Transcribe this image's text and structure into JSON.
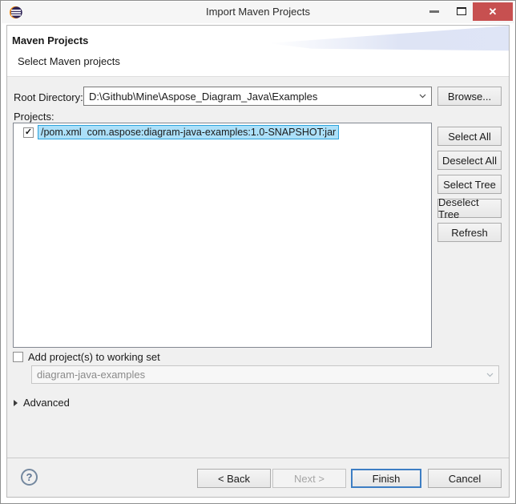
{
  "window": {
    "title": "Import Maven Projects",
    "close_glyph": "✕"
  },
  "header": {
    "title": "Maven Projects",
    "subtitle": "Select Maven projects"
  },
  "form": {
    "root_directory": {
      "label": "Root Directory:",
      "value": "D:\\Github\\Mine\\Aspose_Diagram_Java\\Examples",
      "browse_label": "Browse..."
    },
    "projects_label": "Projects:",
    "project_items": [
      {
        "checked": true,
        "selected": true,
        "label": "/pom.xml  com.aspose:diagram-java-examples:1.0-SNAPSHOT:jar"
      }
    ],
    "side_buttons": [
      "Select All",
      "Deselect All",
      "Select Tree",
      "Deselect Tree",
      "Refresh"
    ],
    "working_set": {
      "label": "Add project(s) to working set",
      "checked": false,
      "combo_value": "diagram-java-examples",
      "combo_enabled": false
    },
    "advanced_label": "Advanced"
  },
  "footer": {
    "help": "?",
    "back_label": "< Back",
    "next_label": "Next >",
    "next_enabled": false,
    "finish_label": "Finish",
    "cancel_label": "Cancel"
  },
  "glyphs": {
    "check": "✓"
  },
  "colors": {
    "close_button": "#C75050",
    "selection_bg": "#ACE0F9",
    "selection_border": "#2DA3DC",
    "default_button_border": "#3D7EC4",
    "eclipse_dark": "#2C2255",
    "eclipse_orange": "#F7941E"
  }
}
